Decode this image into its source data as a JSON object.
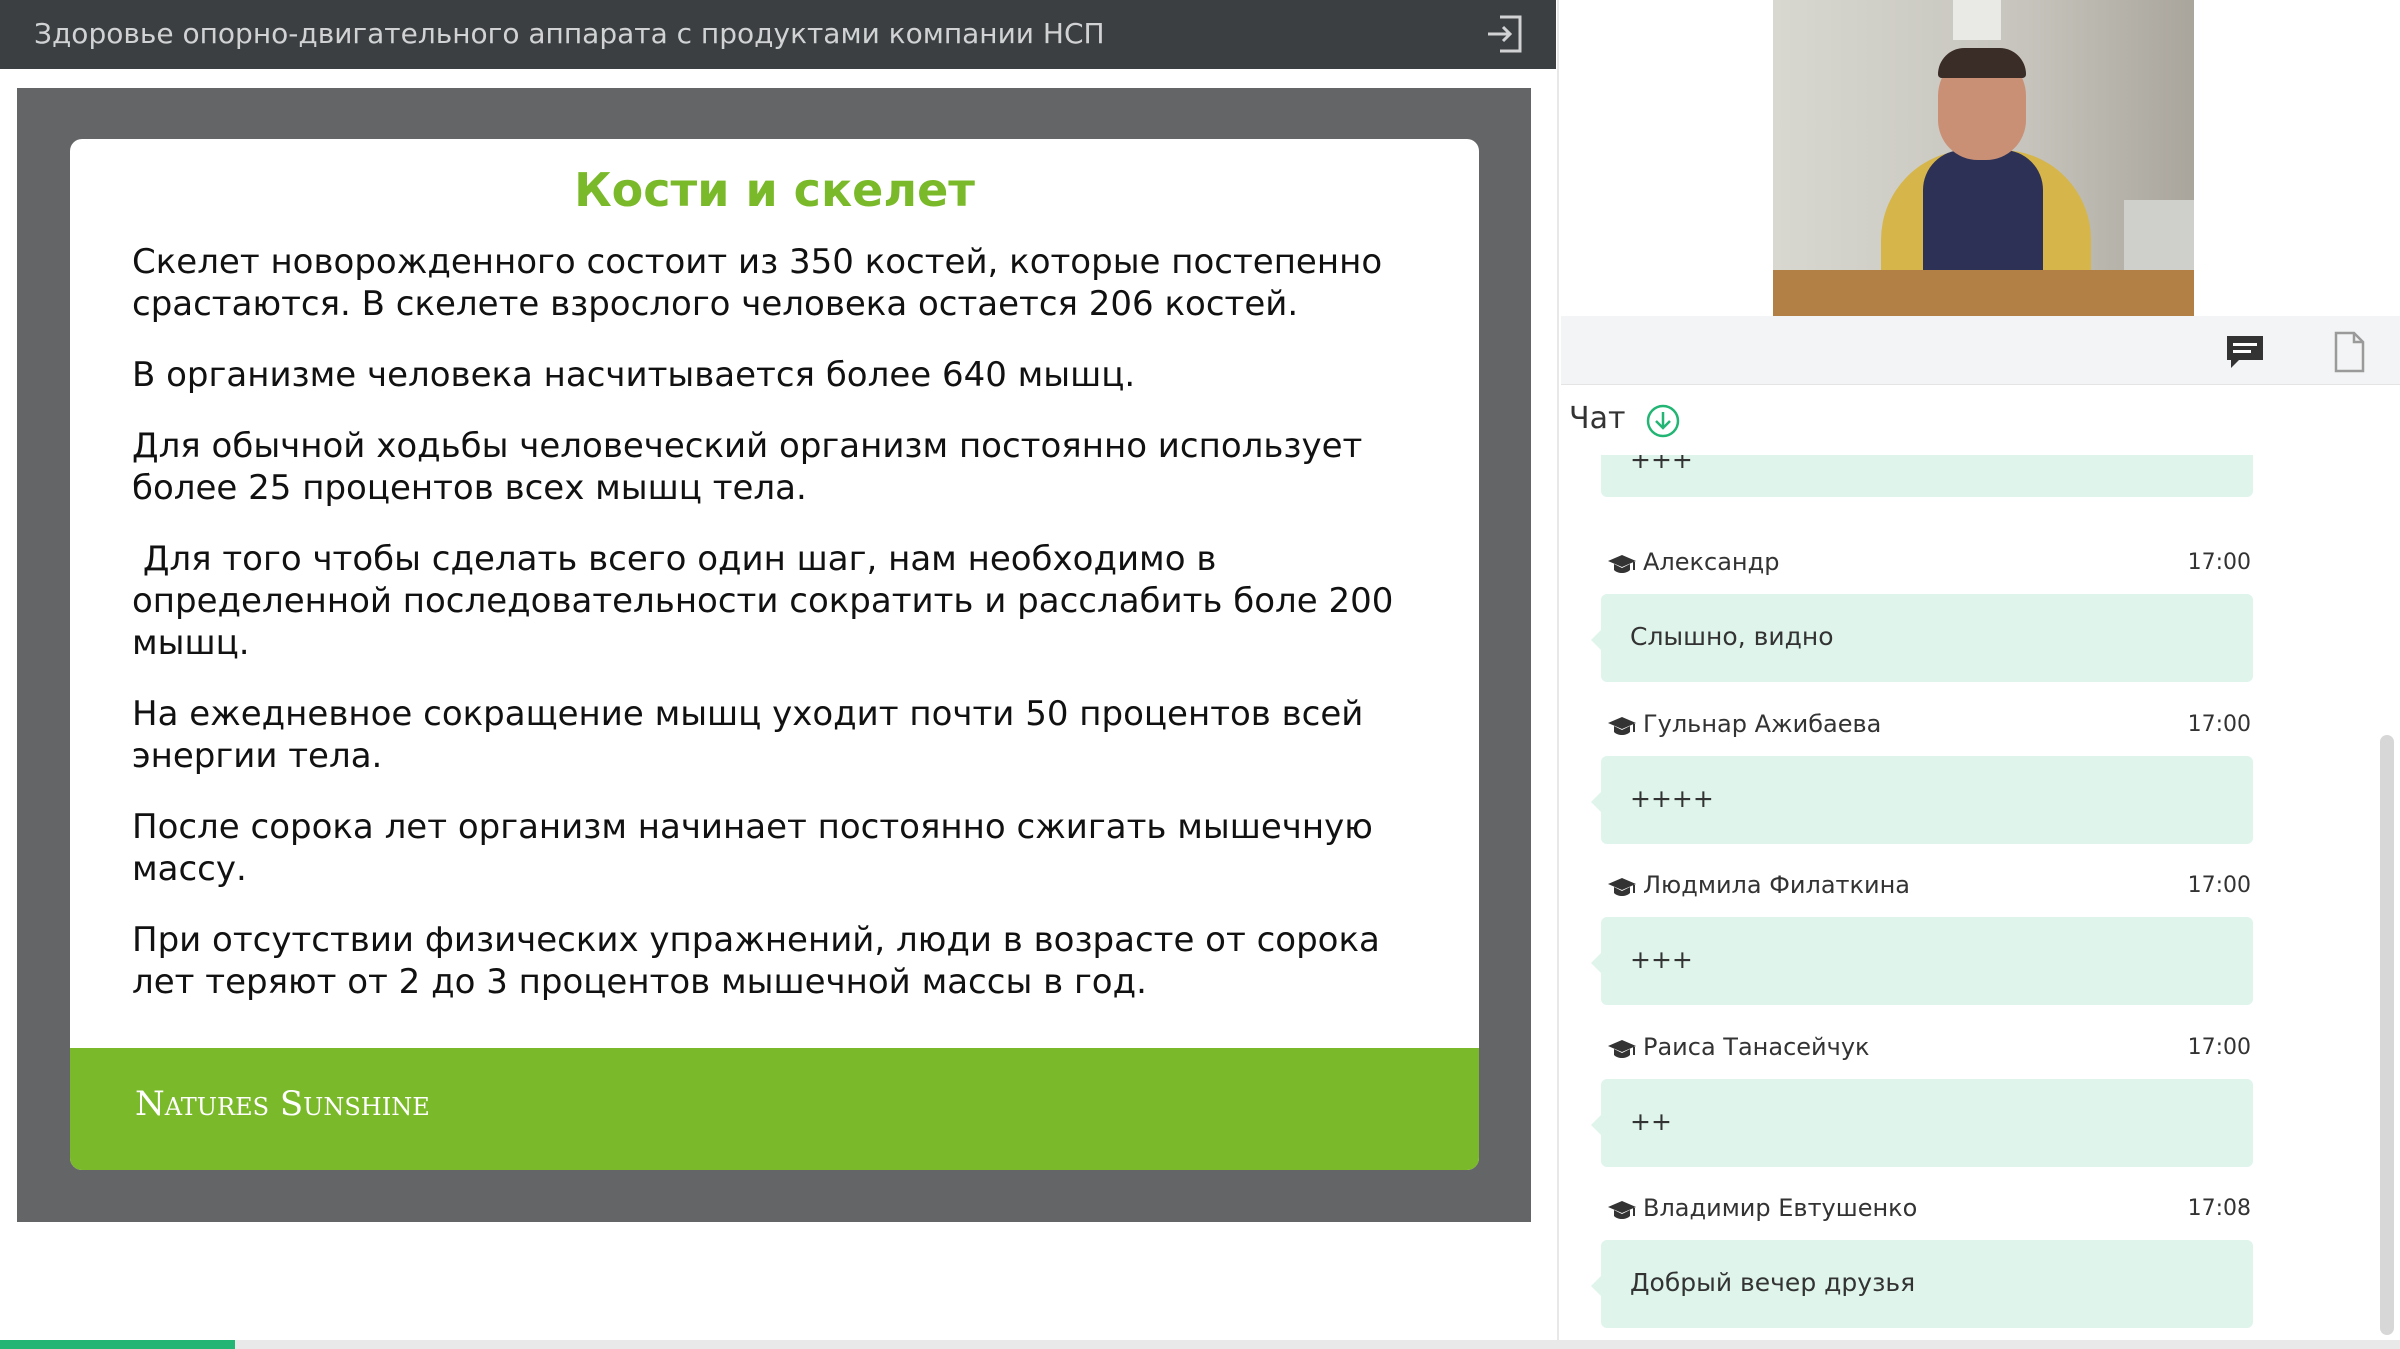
{
  "topbar": {
    "title": "Здоровье опорно-двигательного аппарата с продуктами компании НСП",
    "exit_icon": "exit-icon"
  },
  "slide": {
    "title": "Кости и скелет",
    "paragraphs": [
      "Скелет новорожденного состоит из 350 костей, которые постепенно\nсрастаются. В скелете взрослого человека остается 206 костей.",
      "В организме человека насчитывается более 640 мышц.",
      "Для обычной ходьбы человеческий организм постоянно использует\nболее 25 процентов всех мышц тела.",
      " Для того чтобы сделать всего один шаг, нам необходимо в\nопределенной последовательности сократить и расслабить боле 200\nмышц.",
      "На ежедневное сокращение мышц уходит почти 50 процентов всей\nэнергии тела.",
      "После сорока лет организм начинает постоянно сжигать мышечную\nмассу.",
      "При отсутствии физических упражнений, люди в возрасте от сорока\nлет теряют от 2 до 3 процентов мышечной массы в год."
    ],
    "brand": "Natures Sunshine",
    "colors": {
      "accent": "#7ab929",
      "frame": "#646566"
    }
  },
  "panel": {
    "toolbar": {
      "chat_icon": "chat-icon",
      "document_icon": "document-icon"
    },
    "chat": {
      "title": "Чат",
      "download_icon": "download-icon",
      "partial_message": "+++",
      "messages": [
        {
          "author": "Александр",
          "time": "17:00",
          "text": "Слышно, видно"
        },
        {
          "author": "Гульнар Ажибаева",
          "time": "17:00",
          "text": "++++"
        },
        {
          "author": "Людмила Филаткина",
          "time": "17:00",
          "text": "+++"
        },
        {
          "author": "Раиса Танасейчук",
          "time": "17:00",
          "text": "++"
        },
        {
          "author": "Владимир Евтушенко",
          "time": "17:08",
          "text": "Добрый вечер друзья"
        }
      ],
      "colors": {
        "bubble": "#dff5ec",
        "status": "#22b573"
      }
    }
  },
  "progress": {
    "fraction": 0.098
  }
}
